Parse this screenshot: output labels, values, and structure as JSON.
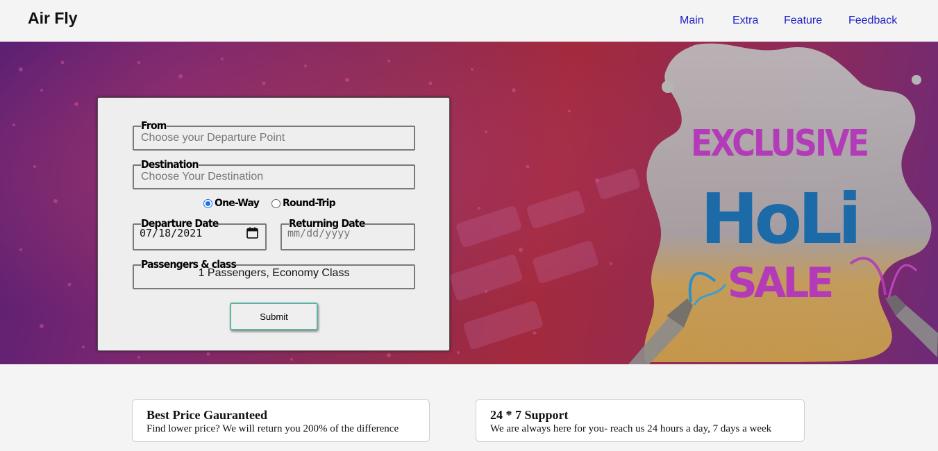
{
  "header": {
    "brand": "Air Fly",
    "nav": [
      "Main",
      "Extra",
      "Feature",
      "Feedback"
    ]
  },
  "banner": {
    "line1": "EXCLUSIVE",
    "line2": "HoLi",
    "line3": "SALE"
  },
  "form": {
    "from_label": "From",
    "from_placeholder": "Choose your Departure Point",
    "destination_label": "Destination",
    "destination_placeholder": "Choose Your Destination",
    "trip_options": [
      {
        "label": "One-Way",
        "selected": true
      },
      {
        "label": "Round-Trip",
        "selected": false
      }
    ],
    "departure_label": "Departure Date",
    "departure_value": "07/18/2021",
    "returning_label": "Returning Date",
    "returning_placeholder": "mm/dd/yyyy",
    "passengers_label": "Passengers & class",
    "passengers_value": "1 Passengers, Economy Class",
    "submit_label": "Submit"
  },
  "features": [
    {
      "title": "Best Price Gauranteed",
      "text": "Find lower price? We will return you 200% of the difference"
    },
    {
      "title": "24 * 7 Support",
      "text": "We are always here for you- reach us 24 hours a day, 7 days a week"
    }
  ],
  "colors": {
    "nav_link": "#1f1fc9",
    "radio_accent": "#1a73e8",
    "submit_border": "#5fb3a5",
    "banner_text_purple": "#b43bb8",
    "banner_text_blue": "#1d6aa8"
  }
}
